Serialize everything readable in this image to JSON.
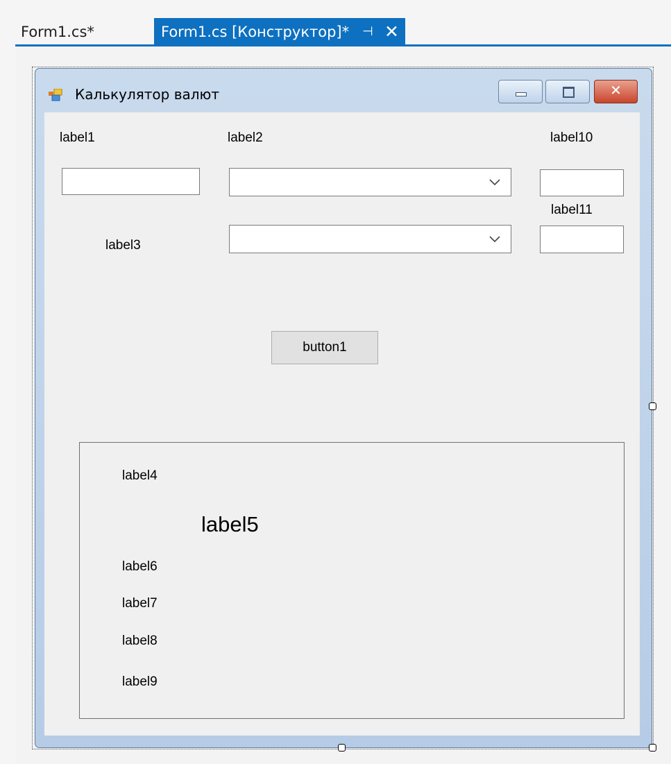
{
  "tabs": [
    {
      "label": "Form1.cs*",
      "active": false
    },
    {
      "label": "Form1.cs [Конструктор]*",
      "active": true
    }
  ],
  "tab_icons": {
    "pin": "pin-icon",
    "close": "close-icon"
  },
  "form": {
    "title": "Калькулятор валют",
    "icon": "form-icon",
    "window_buttons": [
      "minimize-icon",
      "maximize-icon",
      "close-icon"
    ]
  },
  "labels": {
    "label1": "label1",
    "label2": "label2",
    "label3": "label3",
    "label4": "label4",
    "label5": "label5",
    "label6": "label6",
    "label7": "label7",
    "label8": "label8",
    "label9": "label9",
    "label10": "label10",
    "label11": "label11"
  },
  "inputs": {
    "textbox1": "",
    "textbox2": "",
    "textbox3": "",
    "combo1": "",
    "combo2": ""
  },
  "button1": "button1",
  "colors": {
    "accent": "#0e70c0",
    "form_frame": "#b9cfe8",
    "client_bg": "#f0f0f0",
    "close_button": "#c8452c"
  }
}
